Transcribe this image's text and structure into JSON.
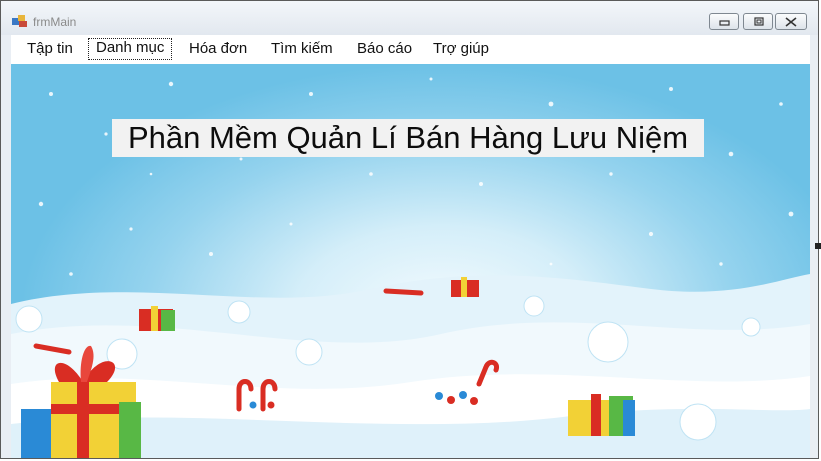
{
  "window": {
    "title": "frmMain",
    "controls": [
      "minimize-icon",
      "maximize-icon",
      "close-icon"
    ]
  },
  "menu": {
    "items": [
      {
        "label": "Tập tin"
      },
      {
        "label": "Danh mục",
        "focused": true
      },
      {
        "label": "Hóa đơn"
      },
      {
        "label": "Tìm kiếm"
      },
      {
        "label": "Báo cáo"
      },
      {
        "label": "Trợ giúp"
      }
    ]
  },
  "main": {
    "banner_text": "Phần Mềm Quản Lí Bán Hàng Lưu Niệm",
    "background": "winter-christmas-scene"
  },
  "colors": {
    "sky": "#6cc1e6",
    "snow": "#eef8fd",
    "banner_bg": "#f2f2f2"
  }
}
